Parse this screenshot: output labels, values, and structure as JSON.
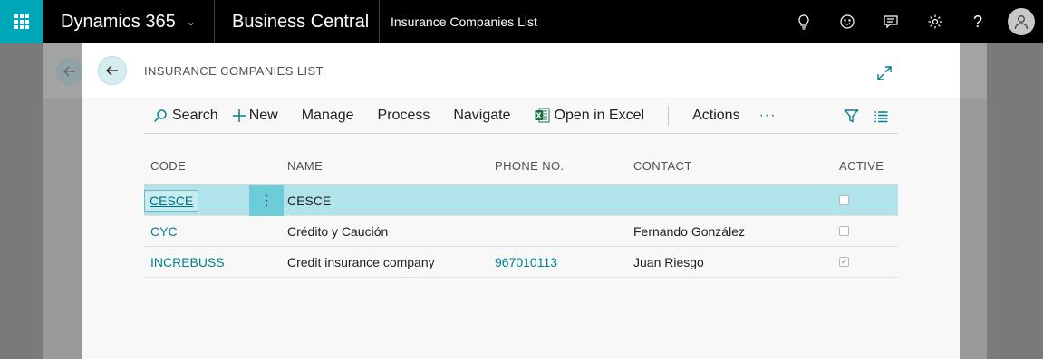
{
  "topbar": {
    "brand": "Dynamics 365",
    "product": "Business Central",
    "breadcrumb": "Insurance Companies List",
    "accent": "#00a5b8"
  },
  "page": {
    "title": "INSURANCE COMPANIES LIST"
  },
  "actions": {
    "search": "Search",
    "new": "New",
    "manage": "Manage",
    "process": "Process",
    "navigate": "Navigate",
    "open_excel": "Open in Excel",
    "actions": "Actions",
    "more": "···"
  },
  "table": {
    "headers": {
      "code": "CODE",
      "name": "NAME",
      "phone": "PHONE NO.",
      "contact": "CONTACT",
      "active": "ACTIVE"
    },
    "rows": [
      {
        "code": "CESCE",
        "name": "CESCE",
        "phone": "",
        "contact": "",
        "active": false,
        "selected": true
      },
      {
        "code": "CYC",
        "name": "Crédito y Caución",
        "phone": "",
        "contact": "Fernando González",
        "active": false,
        "selected": false
      },
      {
        "code": "INCREBUSS",
        "name": "Credit insurance company",
        "phone": "967010113",
        "contact": "Juan Riesgo",
        "active": true,
        "selected": false
      }
    ]
  }
}
